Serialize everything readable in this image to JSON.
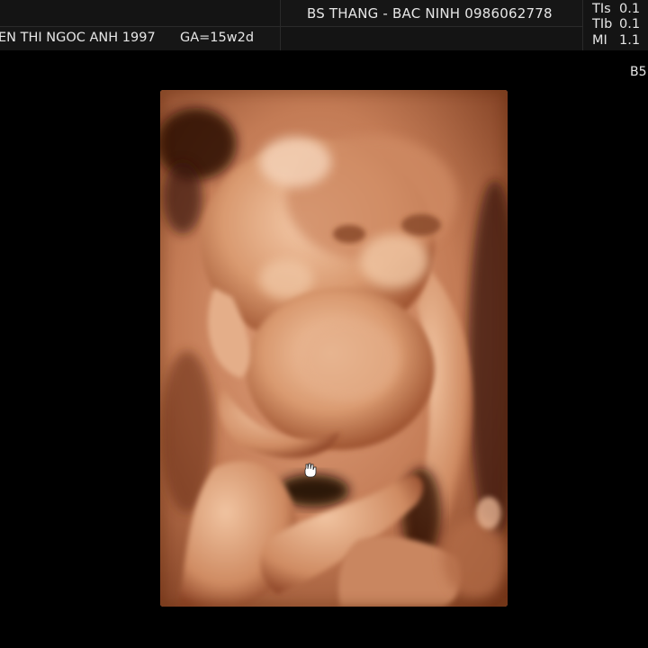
{
  "header": {
    "doctor_info": "BS THANG - BAC NINH 0986062778",
    "patient_name": "EN THI NGOC ANH 1997",
    "gestational_age": "GA=15w2d"
  },
  "metrics": [
    {
      "label": "TIs",
      "value": "0.1"
    },
    {
      "label": "TIb",
      "value": "0.1"
    },
    {
      "label": "MI",
      "value": "1.1"
    }
  ],
  "probe_label": "B5",
  "cursor_icon": "hand-cursor-icon",
  "colors": {
    "background": "#000000",
    "render_skin": "#c98660",
    "render_highlight": "#efc3a2",
    "render_shadow": "#6e3218",
    "text": "#e6e6e6"
  }
}
